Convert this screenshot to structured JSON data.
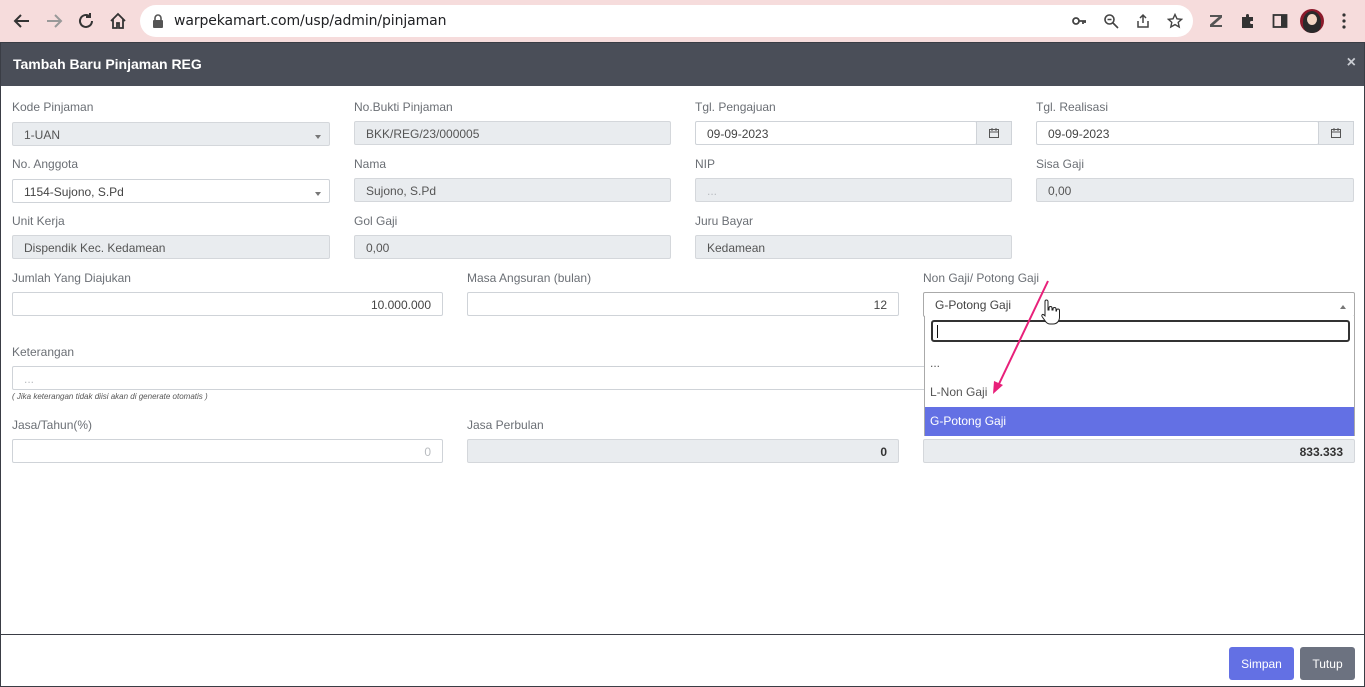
{
  "browser": {
    "url": "warpekamart.com/usp/admin/pinjaman"
  },
  "modal": {
    "title": "Tambah Baru Pinjaman REG",
    "close_symbol": "×"
  },
  "form": {
    "kode_pinjaman": {
      "label": "Kode Pinjaman",
      "value": "1-UAN"
    },
    "no_bukti": {
      "label": "No.Bukti Pinjaman",
      "value": "BKK/REG/23/000005"
    },
    "tgl_pengajuan": {
      "label": "Tgl. Pengajuan",
      "value": "09-09-2023"
    },
    "tgl_realisasi": {
      "label": "Tgl. Realisasi",
      "value": "09-09-2023"
    },
    "no_anggota": {
      "label": "No. Anggota",
      "value": "1154-Sujono, S.Pd"
    },
    "nama": {
      "label": "Nama",
      "value": "Sujono, S.Pd"
    },
    "nip": {
      "label": "NIP",
      "value": "..."
    },
    "sisa_gaji": {
      "label": "Sisa Gaji",
      "value": "0,00"
    },
    "unit_kerja": {
      "label": "Unit Kerja",
      "value": "Dispendik Kec. Kedamean"
    },
    "gol_gaji": {
      "label": "Gol Gaji",
      "value": "0,00"
    },
    "juru_bayar": {
      "label": "Juru Bayar",
      "value": "Kedamean"
    },
    "jumlah": {
      "label": "Jumlah Yang Diajukan",
      "value": "10.000.000"
    },
    "masa_angsuran": {
      "label": "Masa Angsuran (bulan)",
      "value": "12"
    },
    "non_gaji": {
      "label": "Non Gaji/ Potong Gaji",
      "value": "G-Potong Gaji"
    },
    "keterangan": {
      "label": "Keterangan",
      "placeholder": "...",
      "hint": "( Jika keterangan tidak diisi akan di generate otomatis )"
    },
    "jasa_tahun": {
      "label": "Jasa/Tahun(%)",
      "placeholder": "0"
    },
    "jasa_perbulan": {
      "label": "Jasa Perbulan",
      "value": "0"
    },
    "angsuran_total": {
      "value": "833.333"
    }
  },
  "dropdown": {
    "options": [
      "...",
      "L-Non Gaji",
      "G-Potong Gaji"
    ],
    "selected": "G-Potong Gaji"
  },
  "footer": {
    "save_label": "Simpan",
    "close_label": "Tutup"
  },
  "colors": {
    "header_bg": "#4a4e58",
    "accent": "#6370e4",
    "annotation_arrow": "#e8207a"
  }
}
